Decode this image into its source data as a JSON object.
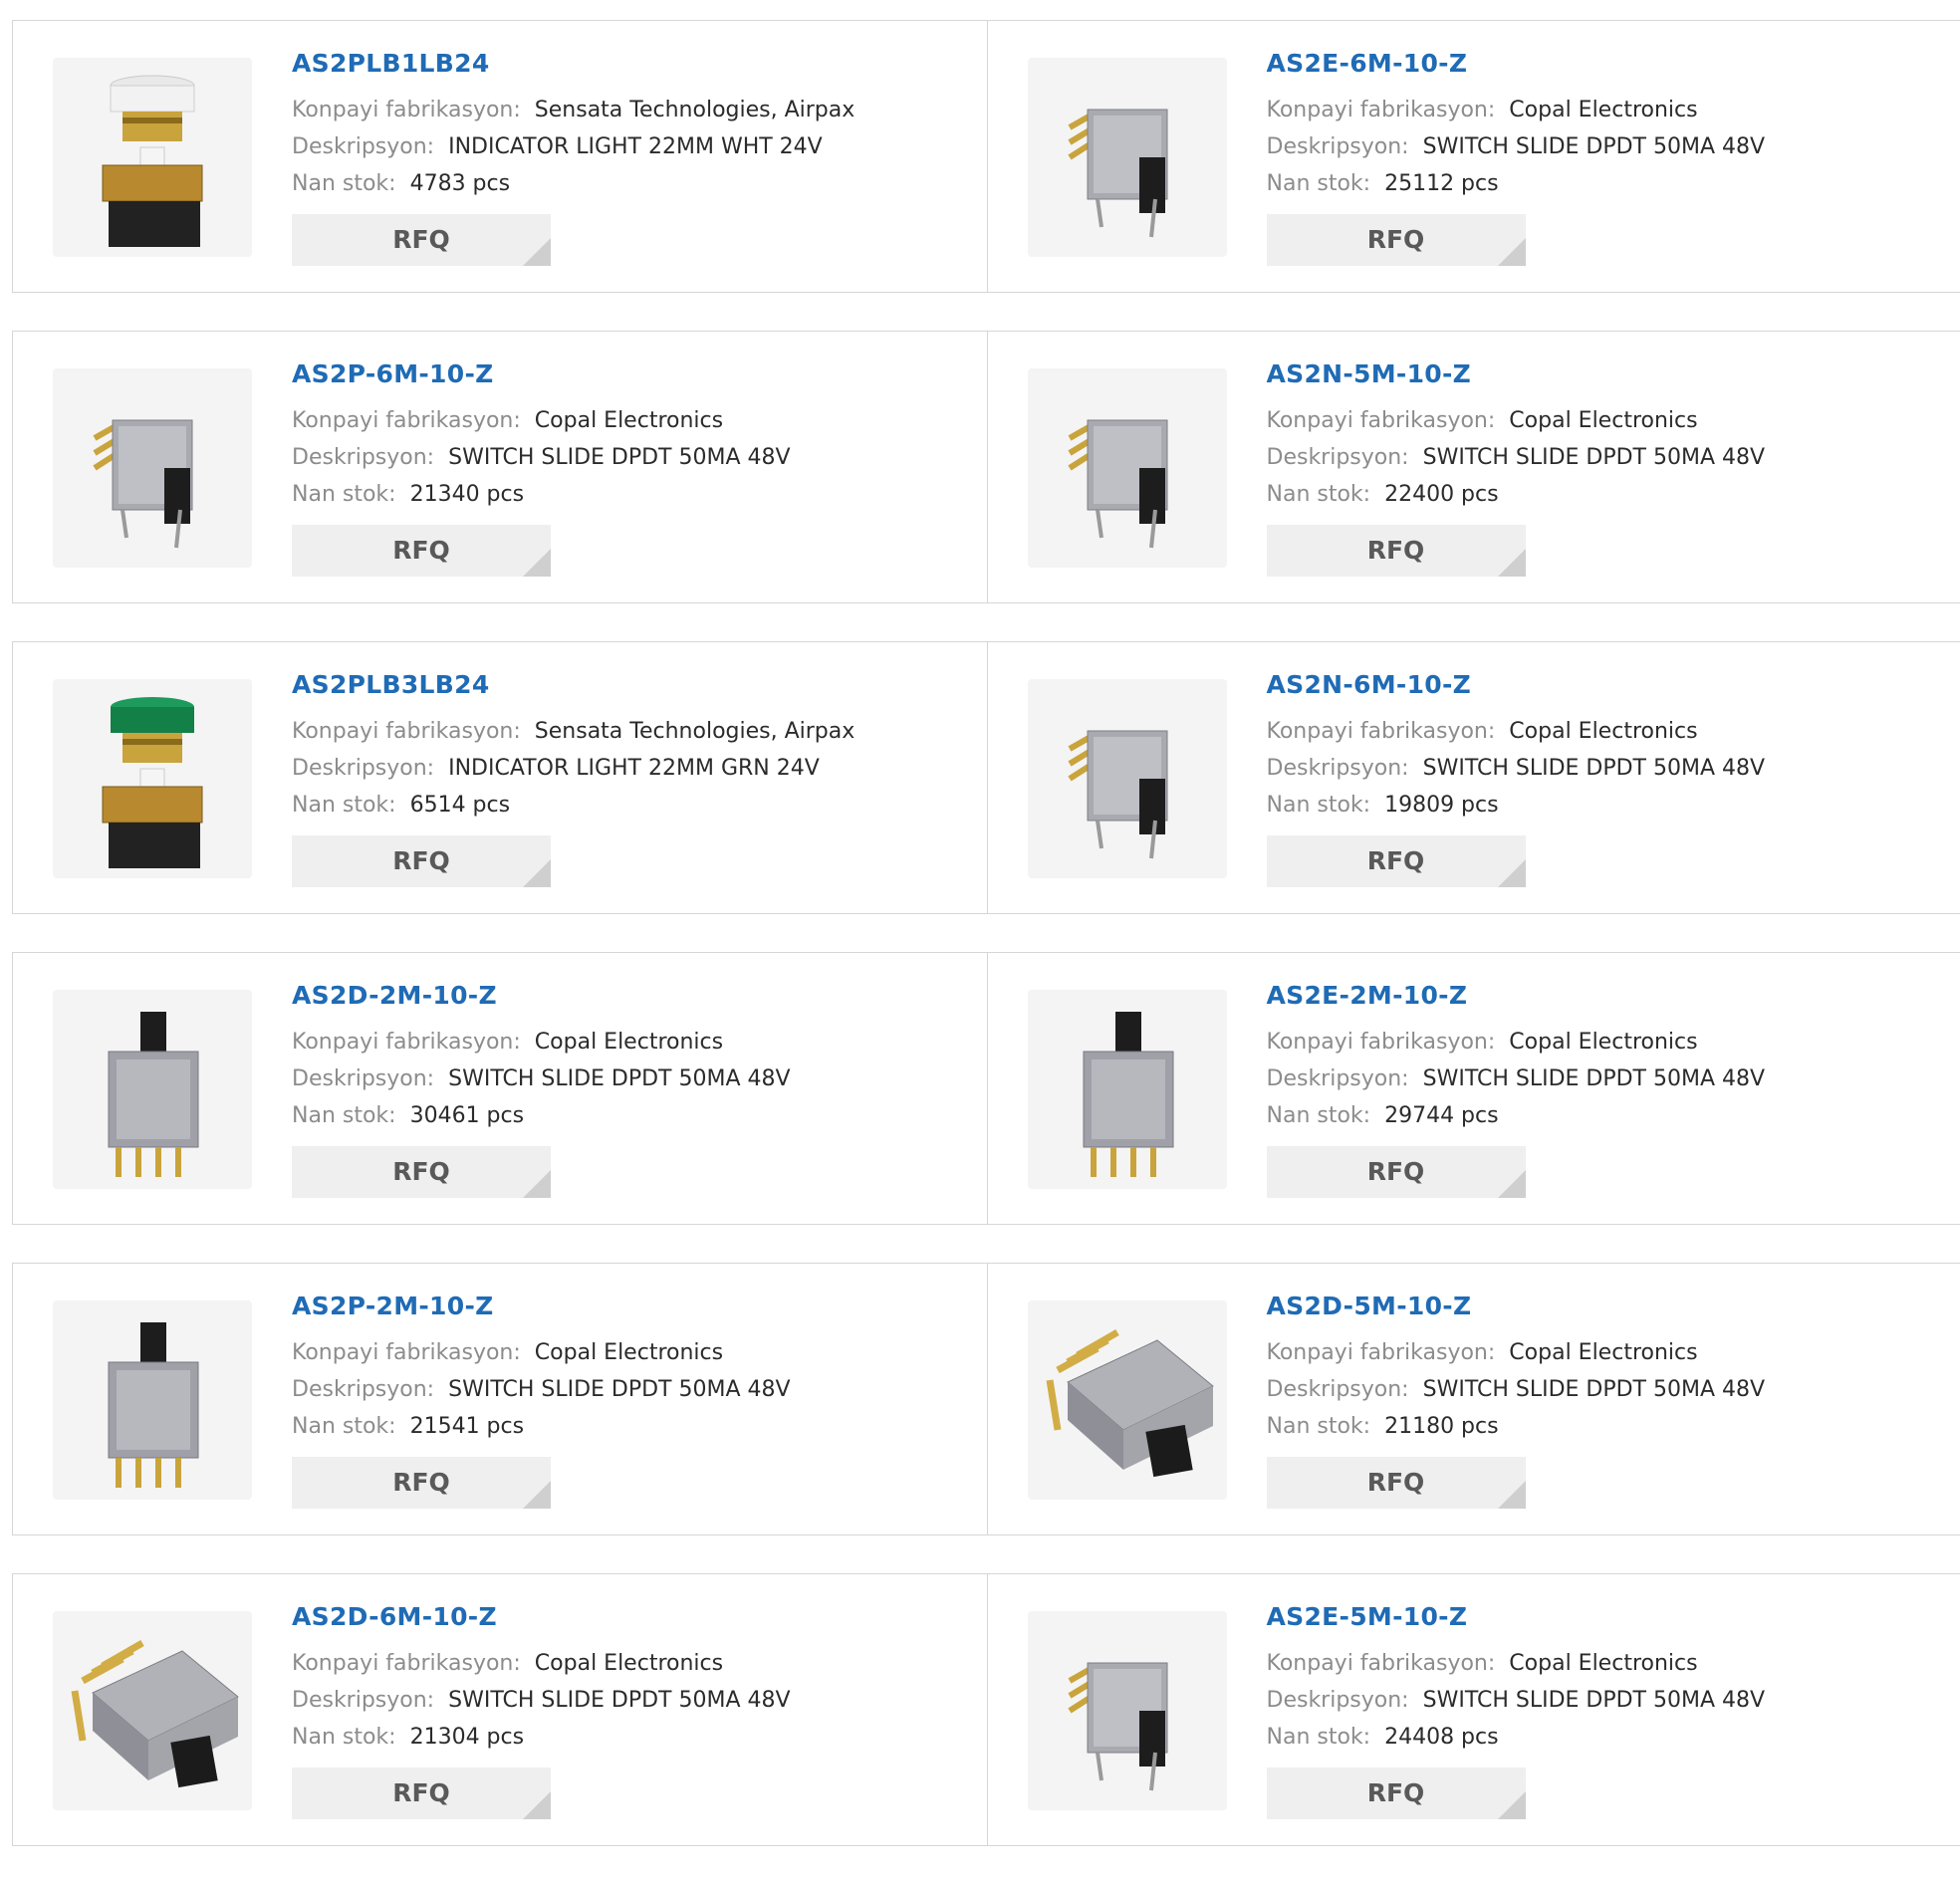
{
  "labels": {
    "manufacturer": "Konpayi fabrikasyon:",
    "description": "Deskripsyon:",
    "stock": "Nan stok:",
    "rfq": "RFQ"
  },
  "products": [
    {
      "part": "AS2PLB1LB24",
      "manufacturer": "Sensata Technologies, Airpax",
      "description": "INDICATOR LIGHT 22MM WHT 24V",
      "stock": "4783 pcs",
      "image": "indicator-light-white"
    },
    {
      "part": "AS2E-6M-10-Z",
      "manufacturer": "Copal Electronics",
      "description": "SWITCH SLIDE DPDT 50MA 48V",
      "stock": "25112 pcs",
      "image": "slide-switch-right-angle"
    },
    {
      "part": "AS2P-6M-10-Z",
      "manufacturer": "Copal Electronics",
      "description": "SWITCH SLIDE DPDT 50MA 48V",
      "stock": "21340 pcs",
      "image": "slide-switch-right-angle"
    },
    {
      "part": "AS2N-5M-10-Z",
      "manufacturer": "Copal Electronics",
      "description": "SWITCH SLIDE DPDT 50MA 48V",
      "stock": "22400 pcs",
      "image": "slide-switch-right-angle"
    },
    {
      "part": "AS2PLB3LB24",
      "manufacturer": "Sensata Technologies, Airpax",
      "description": "INDICATOR LIGHT 22MM GRN 24V",
      "stock": "6514 pcs",
      "image": "indicator-light-green"
    },
    {
      "part": "AS2N-6M-10-Z",
      "manufacturer": "Copal Electronics",
      "description": "SWITCH SLIDE DPDT 50MA 48V",
      "stock": "19809 pcs",
      "image": "slide-switch-right-angle"
    },
    {
      "part": "AS2D-2M-10-Z",
      "manufacturer": "Copal Electronics",
      "description": "SWITCH SLIDE DPDT 50MA 48V",
      "stock": "30461 pcs",
      "image": "slide-switch-vertical"
    },
    {
      "part": "AS2E-2M-10-Z",
      "manufacturer": "Copal Electronics",
      "description": "SWITCH SLIDE DPDT 50MA 48V",
      "stock": "29744 pcs",
      "image": "slide-switch-vertical"
    },
    {
      "part": "AS2P-2M-10-Z",
      "manufacturer": "Copal Electronics",
      "description": "SWITCH SLIDE DPDT 50MA 48V",
      "stock": "21541 pcs",
      "image": "slide-switch-vertical"
    },
    {
      "part": "AS2D-5M-10-Z",
      "manufacturer": "Copal Electronics",
      "description": "SWITCH SLIDE DPDT 50MA 48V",
      "stock": "21180 pcs",
      "image": "slide-switch-angled-large"
    },
    {
      "part": "AS2D-6M-10-Z",
      "manufacturer": "Copal Electronics",
      "description": "SWITCH SLIDE DPDT 50MA 48V",
      "stock": "21304 pcs",
      "image": "slide-switch-angled-large"
    },
    {
      "part": "AS2E-5M-10-Z",
      "manufacturer": "Copal Electronics",
      "description": "SWITCH SLIDE DPDT 50MA 48V",
      "stock": "24408 pcs",
      "image": "slide-switch-right-angle"
    }
  ]
}
